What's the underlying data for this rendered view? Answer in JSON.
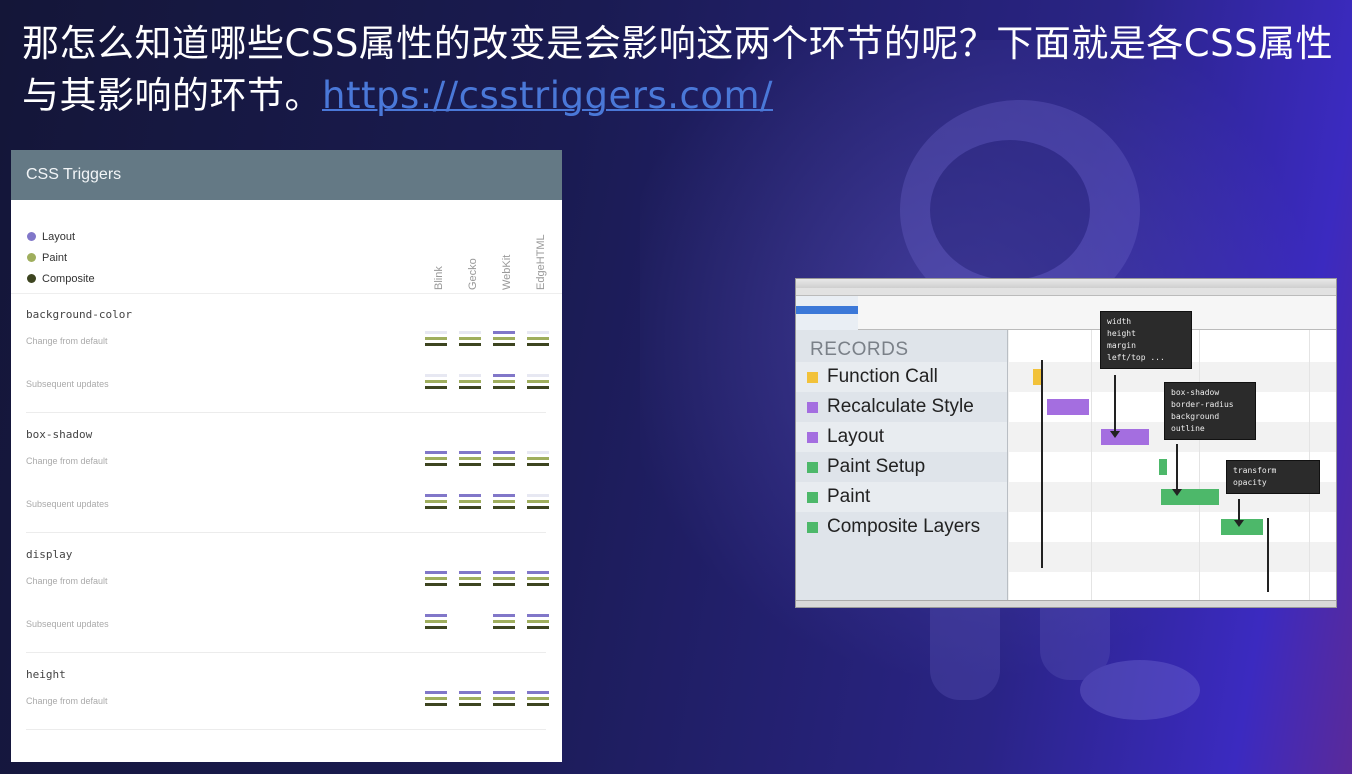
{
  "heading": {
    "text": "那怎么知道哪些CSS属性的改变是会影响这两个环节的呢？下面就是各CSS属性与其影响的环节。",
    "link": "https://csstriggers.com/"
  },
  "triggers": {
    "title": "CSS Triggers",
    "legend": [
      {
        "label": "Layout",
        "color": "#8177c9"
      },
      {
        "label": "Paint",
        "color": "#9fae5d"
      },
      {
        "label": "Composite",
        "color": "#3d4520"
      }
    ],
    "browsers": [
      "Blink",
      "Gecko",
      "WebKit",
      "EdgeHTML"
    ],
    "properties": [
      {
        "name": "background-color",
        "rows": [
          {
            "label": "Change from default",
            "cells": [
              [
                0,
                1,
                1
              ],
              [
                0,
                1,
                1
              ],
              [
                1,
                1,
                1
              ],
              [
                0,
                1,
                1
              ]
            ]
          },
          {
            "label": "Subsequent updates",
            "cells": [
              [
                0,
                1,
                1
              ],
              [
                0,
                1,
                1
              ],
              [
                1,
                1,
                1
              ],
              [
                0,
                1,
                1
              ]
            ]
          }
        ]
      },
      {
        "name": "box-shadow",
        "rows": [
          {
            "label": "Change from default",
            "cells": [
              [
                1,
                1,
                1
              ],
              [
                1,
                1,
                1
              ],
              [
                1,
                1,
                1
              ],
              [
                0,
                1,
                1
              ]
            ]
          },
          {
            "label": "Subsequent updates",
            "cells": [
              [
                1,
                1,
                1
              ],
              [
                1,
                1,
                1
              ],
              [
                1,
                1,
                1
              ],
              [
                0,
                1,
                1
              ]
            ]
          }
        ]
      },
      {
        "name": "display",
        "rows": [
          {
            "label": "Change from default",
            "cells": [
              [
                1,
                1,
                1
              ],
              [
                1,
                1,
                1
              ],
              [
                1,
                1,
                1
              ],
              [
                1,
                1,
                1
              ]
            ]
          },
          {
            "label": "Subsequent updates",
            "cells": [
              [
                1,
                1,
                1
              ],
              [
                0,
                0,
                0
              ],
              [
                1,
                1,
                1
              ],
              [
                1,
                1,
                1
              ]
            ]
          }
        ]
      },
      {
        "name": "height",
        "rows": [
          {
            "label": "Change from default",
            "cells": [
              [
                1,
                1,
                1
              ],
              [
                1,
                1,
                1
              ],
              [
                1,
                1,
                1
              ],
              [
                1,
                1,
                1
              ]
            ]
          }
        ]
      }
    ],
    "bar_colors": {
      "layout": "#8177c9",
      "paint": "#9fae5d",
      "composite": "#3d4520",
      "empty": "#e7e8f2"
    }
  },
  "devtools": {
    "records_title": "RECORDS",
    "records": [
      {
        "label": "Function Call",
        "color": "#f2c23a"
      },
      {
        "label": "Recalculate Style",
        "color": "#a46ee0"
      },
      {
        "label": "Layout",
        "color": "#a46ee0"
      },
      {
        "label": "Paint Setup",
        "color": "#4db86a"
      },
      {
        "label": "Paint",
        "color": "#4db86a"
      },
      {
        "label": "Composite Layers",
        "color": "#4db86a"
      }
    ],
    "tooltips": [
      {
        "text": "width\nheight\nmargin\nleft/top ..."
      },
      {
        "text": "box-shadow\nborder-radius\nbackground\noutline"
      },
      {
        "text": "transform\nopacity"
      }
    ]
  }
}
